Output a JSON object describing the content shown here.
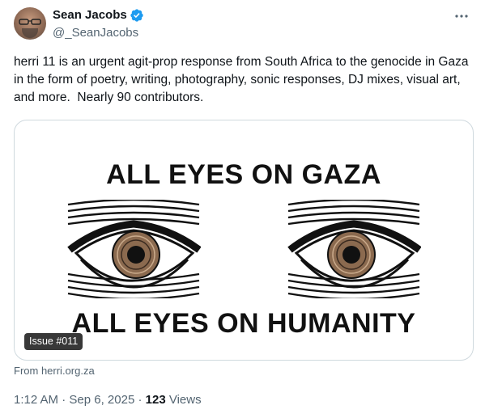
{
  "author": {
    "display_name": "Sean Jacobs",
    "handle": "@_SeanJacobs",
    "verified": true
  },
  "tweet": {
    "text": "herri 11 is an urgent agit-prop response from South Africa to the genocide in Gaza in the form of poetry, writing, photography, sonic responses, DJ mixes, visual art, and more.  Nearly 90 contributors."
  },
  "card": {
    "headline_top": "ALL EYES ON GAZA",
    "headline_bottom": "ALL EYES ON HUMANITY",
    "badge": "Issue #011",
    "source": "From herri.org.za"
  },
  "meta": {
    "time": "1:12 AM",
    "separator": " · ",
    "date": "Sep 6, 2025",
    "views_count": "123",
    "views_label": " Views"
  },
  "icons": {
    "verified": "verified-badge-icon",
    "more": "more-options-icon"
  },
  "colors": {
    "verified_blue": "#1d9bf0",
    "muted_text": "#536471",
    "iris": "#8b6a4f"
  }
}
